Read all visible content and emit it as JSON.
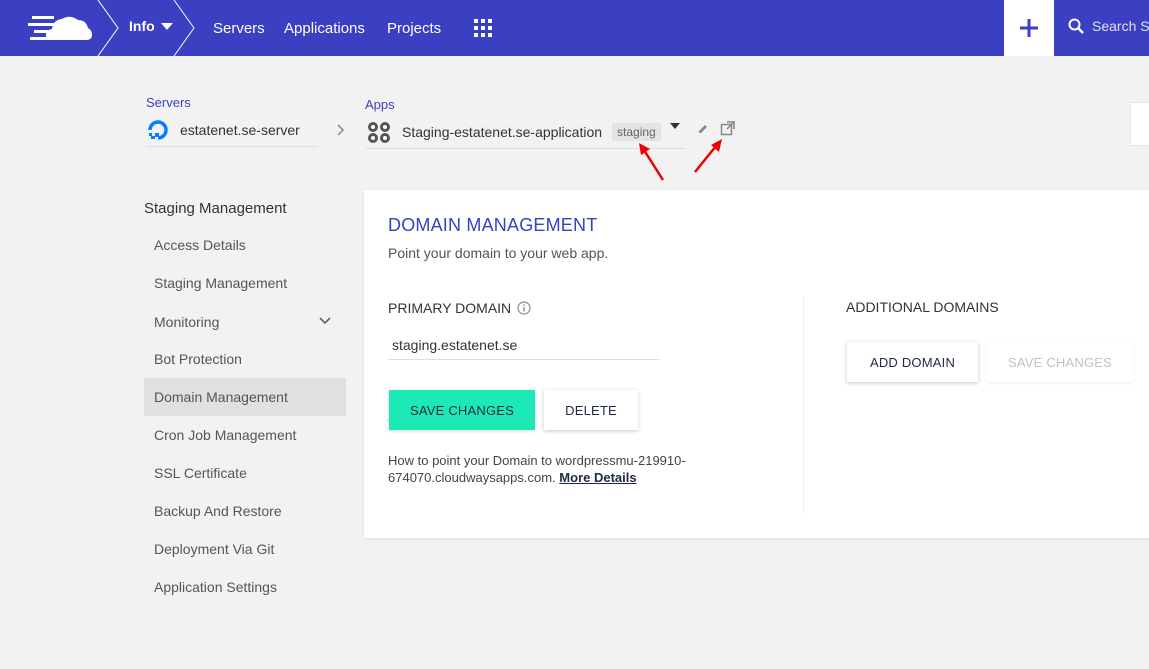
{
  "topbar": {
    "info_label": "Info",
    "nav": [
      "Servers",
      "Applications",
      "Projects"
    ],
    "search_placeholder": "Search S",
    "colors": {
      "bar": "#3b3fc1",
      "accent": "#1de9b6"
    }
  },
  "selectors": {
    "servers_label": "Servers",
    "server_name": "estatenet.se-server",
    "apps_label": "Apps",
    "app_name": "Staging-estatenet.se-application",
    "app_badge": "staging"
  },
  "sidebar": {
    "title": "Staging Management",
    "items": [
      {
        "label": "Access Details"
      },
      {
        "label": "Staging Management"
      },
      {
        "label": "Monitoring"
      },
      {
        "label": "Bot Protection"
      },
      {
        "label": "Domain Management"
      },
      {
        "label": "Cron Job Management"
      },
      {
        "label": "SSL Certificate"
      },
      {
        "label": "Backup And Restore"
      },
      {
        "label": "Deployment Via Git"
      },
      {
        "label": "Application Settings"
      }
    ]
  },
  "card": {
    "title": "DOMAIN MANAGEMENT",
    "subtitle": "Point your domain to your web app.",
    "primary_label": "PRIMARY DOMAIN",
    "primary_value": "staging.estatenet.se",
    "save_label": "SAVE CHANGES",
    "delete_label": "DELETE",
    "help_text": "How to point your Domain to wordpressmu-219910-674070.cloudwaysapps.com.",
    "help_link": "More Details",
    "additional_label": "ADDITIONAL DOMAINS",
    "add_domain_label": "ADD DOMAIN",
    "save_changes_disabled_label": "SAVE CHANGES"
  }
}
